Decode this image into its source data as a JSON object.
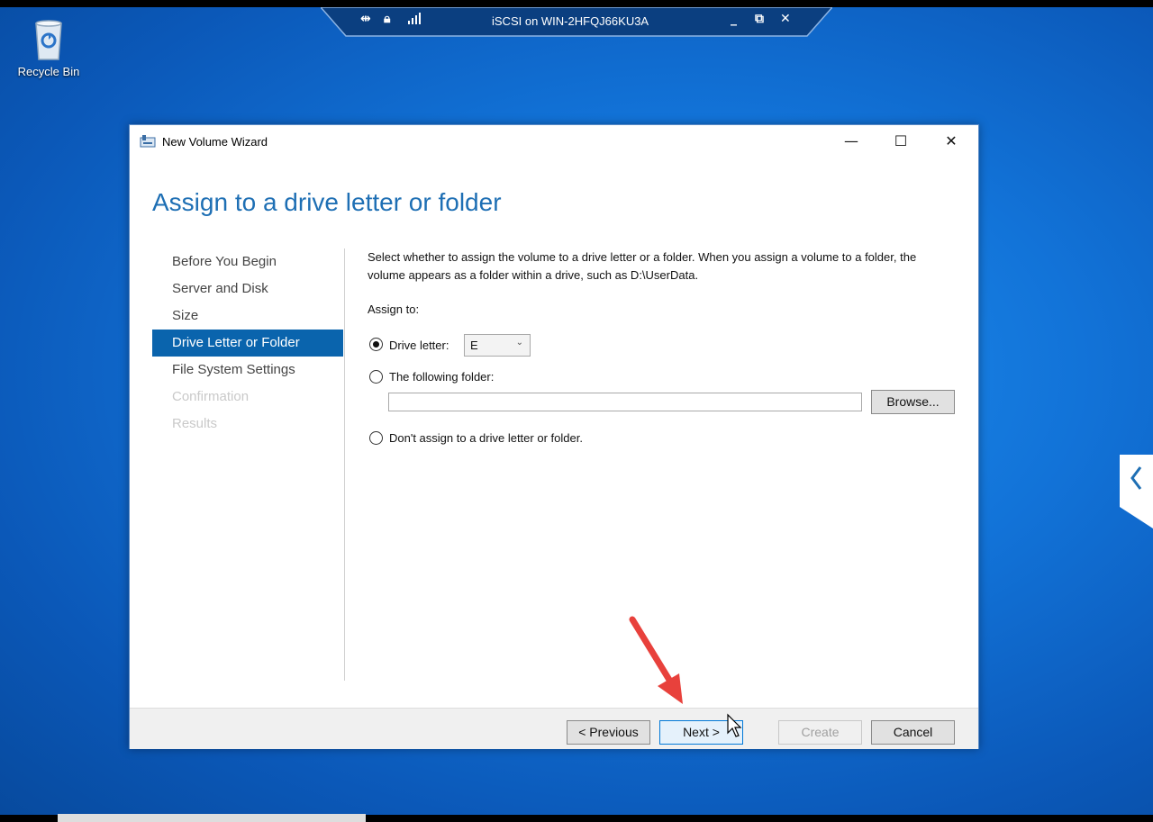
{
  "remote_bar": {
    "title": "iSCSI on WIN-2HFQJ66KU3A",
    "icons": [
      "pin-icon",
      "lock-icon",
      "signal-icon"
    ],
    "controls": [
      "minimize-icon",
      "restore-icon",
      "close-icon"
    ]
  },
  "desktop": {
    "recycle_bin_label": "Recycle Bin"
  },
  "window": {
    "title": "New Volume Wizard",
    "controls": {
      "minimize": "—",
      "maximize": "☐",
      "close": "✕"
    }
  },
  "wizard": {
    "heading": "Assign to a drive letter or folder",
    "steps": [
      {
        "label": "Before You Begin",
        "state": "normal"
      },
      {
        "label": "Server and Disk",
        "state": "normal"
      },
      {
        "label": "Size",
        "state": "normal"
      },
      {
        "label": "Drive Letter or Folder",
        "state": "active"
      },
      {
        "label": "File System Settings",
        "state": "normal"
      },
      {
        "label": "Confirmation",
        "state": "disabled"
      },
      {
        "label": "Results",
        "state": "disabled"
      }
    ],
    "description": "Select whether to assign the volume to a drive letter or a folder. When you assign a volume to a folder, the volume appears as a folder within a drive, such as D:\\UserData.",
    "assign_to_label": "Assign to:",
    "options": {
      "drive_letter": {
        "label": "Drive letter:",
        "selected": true,
        "value": "E"
      },
      "folder": {
        "label": "The following folder:",
        "selected": false,
        "value": "",
        "browse_label": "Browse..."
      },
      "none": {
        "label": "Don't assign to a drive letter or folder.",
        "selected": false
      }
    }
  },
  "footer": {
    "previous_label": "< Previous",
    "next_label": "Next >",
    "create_label": "Create",
    "cancel_label": "Cancel"
  },
  "colors": {
    "accent": "#0a64ad",
    "heading": "#1e6fb4",
    "annotation_arrow": "#e8413c"
  }
}
